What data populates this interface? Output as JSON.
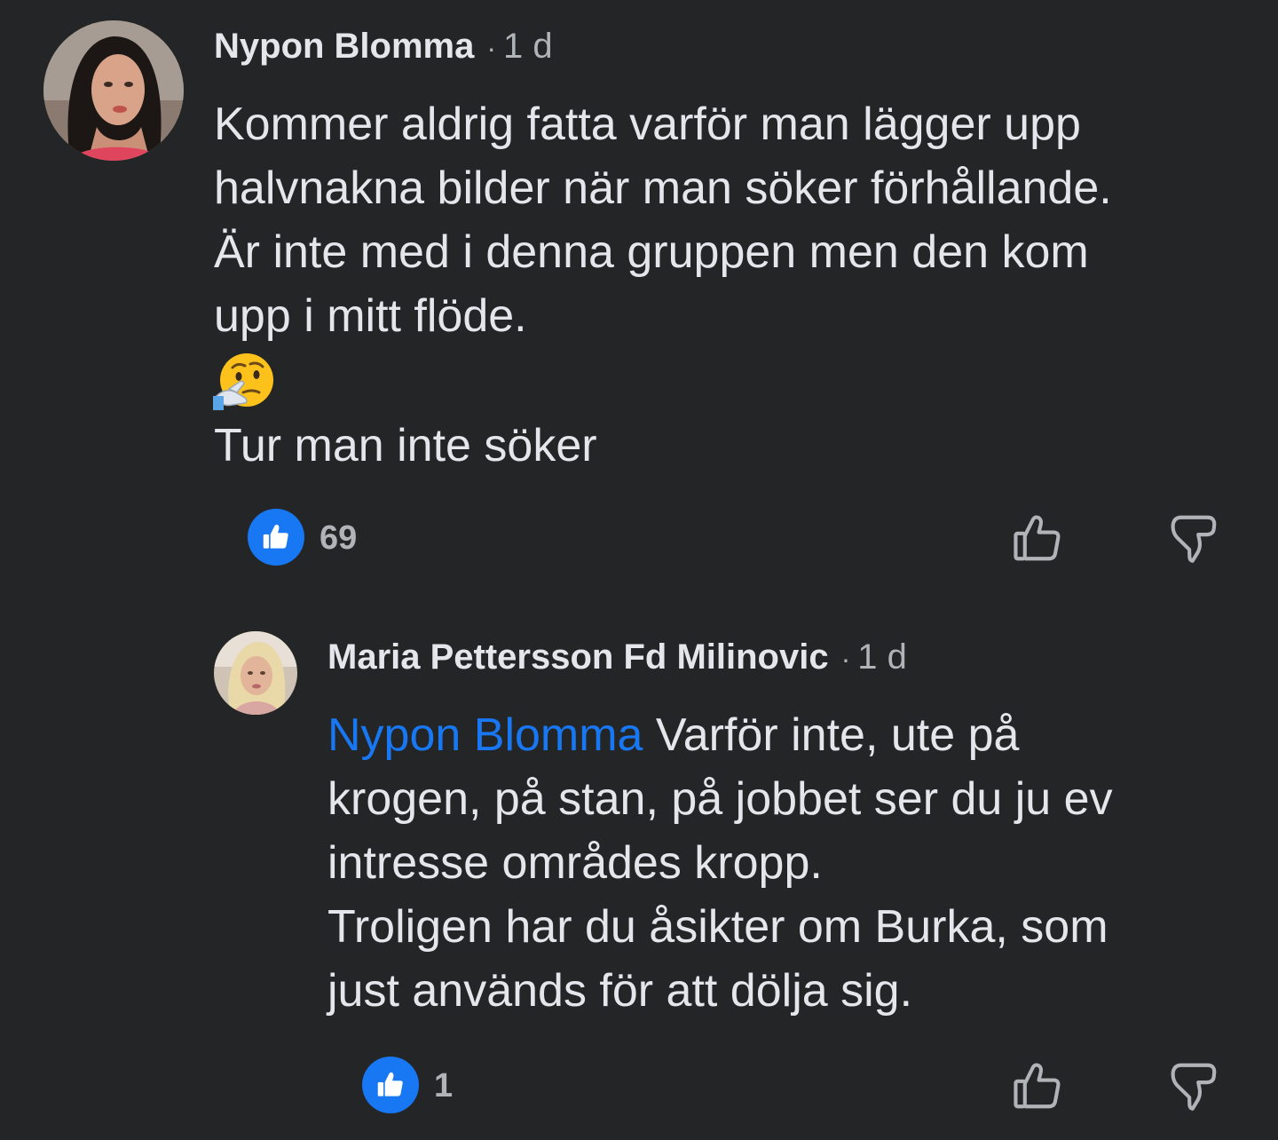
{
  "comment": {
    "author": "Nypon Blomma",
    "separator": "·",
    "time": "1 d",
    "lines": [
      "Kommer aldrig fatta varför man lägger upp",
      "halvnakna bilder när man söker förhållande.",
      "Är inte med i denna gruppen men den kom",
      "upp i mitt flöde."
    ],
    "emoji_icon": "thinking-face-icon",
    "last_line": "Tur man inte söker",
    "reaction_icon": "like-icon",
    "reaction_count": "69"
  },
  "reply": {
    "author": "Maria Pettersson Fd Milinovic",
    "separator": "·",
    "time": "1 d",
    "mention": "Nypon Blomma",
    "first_line_rest": " Varför inte, ute på",
    "lines": [
      "krogen, på stan, på jobbet ser du ju ev",
      "intresse områdes kropp.",
      "Troligen har du åsikter om Burka, som",
      "just används för att dölja sig."
    ],
    "reaction_icon": "like-icon",
    "reaction_count": "1"
  },
  "colors": {
    "background": "#242526",
    "text": "#e4e6eb",
    "secondary_text": "#b0b3b8",
    "mention": "#1877f2",
    "like_badge": "#1877f2"
  }
}
